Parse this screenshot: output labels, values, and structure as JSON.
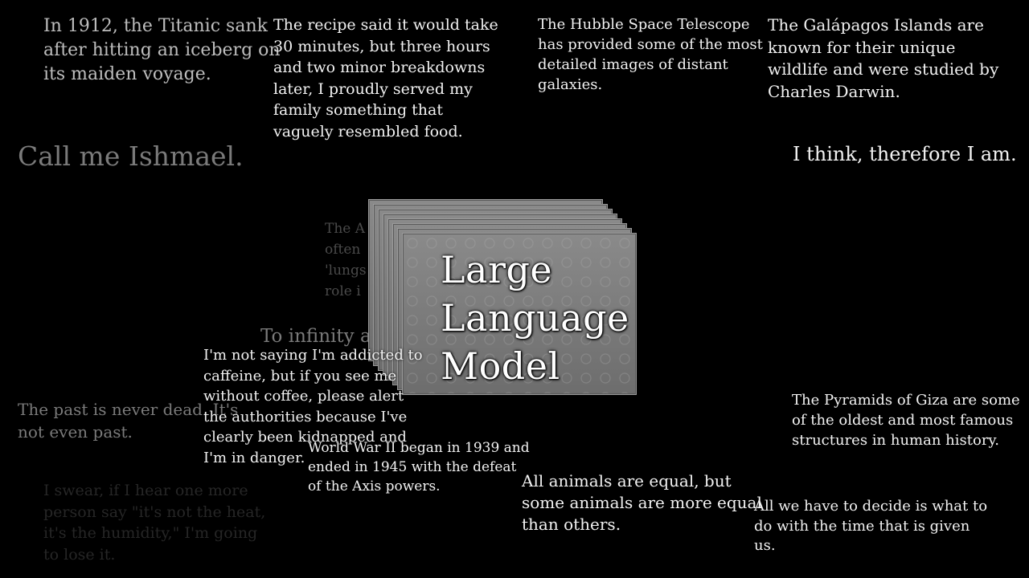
{
  "model": {
    "label": "Large\nLanguage\nModel"
  },
  "snippets": {
    "titanic": "In 1912, the Titanic sank\nafter hitting an iceberg on\nits maiden voyage.",
    "recipe": "The recipe said it would take\n30 minutes, but three hours\nand two minor breakdowns\nlater, I proudly served my\nfamily something that\nvaguely resembled food.",
    "hubble": "The Hubble Space Telescope\nhas provided some of the most\ndetailed images of distant\ngalaxies.",
    "galapagos": "The Galápagos Islands are\nknown for their unique\nwildlife and were studied by\nCharles Darwin.",
    "ishmael": "Call me Ishmael.",
    "descartes": "I think, therefore I am.",
    "amazon_partial": "The A\noften\n'lungs\nrole i",
    "infinity": "To infinity and beyond!",
    "caffeine": "I'm not saying I'm addicted to\ncaffeine, but if you see me\nwithout coffee, please alert\nthe authorities because I've\nclearly been kidnapped and\nI'm in danger.",
    "faulkner": "The past is never dead. It's\nnot even past.",
    "ww2": "World War II began in 1939 and\nended in 1945 with the defeat\nof the Axis powers.",
    "orwell": "All animals are equal, but\nsome animals are more equal\nthan others.",
    "pyramids": "The Pyramids of Giza are some\nof the oldest and most famous\nstructures in human history.",
    "tolkien": "All we have to decide is what to\ndo with the time that is given\nus.",
    "humidity": "I swear, if I hear one more\nperson say \"it's not the heat,\nit's the humidity,\" I'm going\nto lose it."
  }
}
